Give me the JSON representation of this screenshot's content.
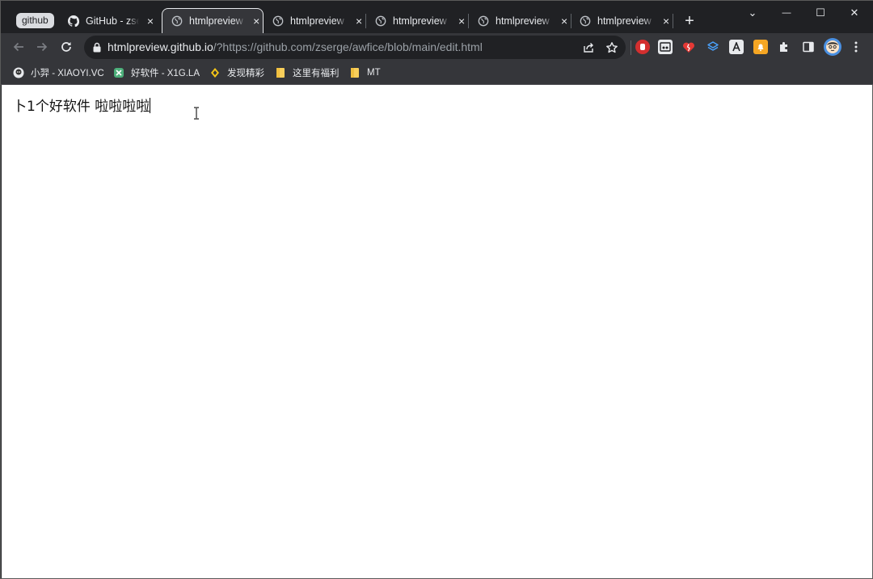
{
  "tabs": {
    "group_label": "github",
    "items": [
      {
        "title": "GitHub - zserge/awfice"
      },
      {
        "title": "htmlpreview"
      },
      {
        "title": "htmlpreview"
      },
      {
        "title": "htmlpreview"
      },
      {
        "title": "htmlpreview"
      },
      {
        "title": "htmlpreview"
      }
    ],
    "close_glyph": "×",
    "new_tab_glyph": "+"
  },
  "window_controls": {
    "list": "⌄",
    "minimize": "—",
    "maximize": "☐",
    "close": "✕"
  },
  "address_bar": {
    "host": "htmlpreview.github.io",
    "path": "/?https://github.com/zserge/awfice/blob/main/edit.html"
  },
  "bookmarks": [
    {
      "label": "小羿 - XIAOYI.VC",
      "icon": "avatar-icon"
    },
    {
      "label": "好软件 - X1G.LA",
      "icon": "x1g-icon"
    },
    {
      "label": "发现精彩",
      "icon": "star-diamond-icon"
    },
    {
      "label": "这里有福利",
      "icon": "folder-icon"
    },
    {
      "label": "MT",
      "icon": "folder-icon"
    }
  ],
  "page": {
    "text": "卜1个好软件 啦啦啦啦"
  },
  "colors": {
    "chrome_dark": "#202124",
    "toolbar": "#35363a",
    "accent_red": "#e53935",
    "folder_yellow": "#f9cf5b"
  }
}
